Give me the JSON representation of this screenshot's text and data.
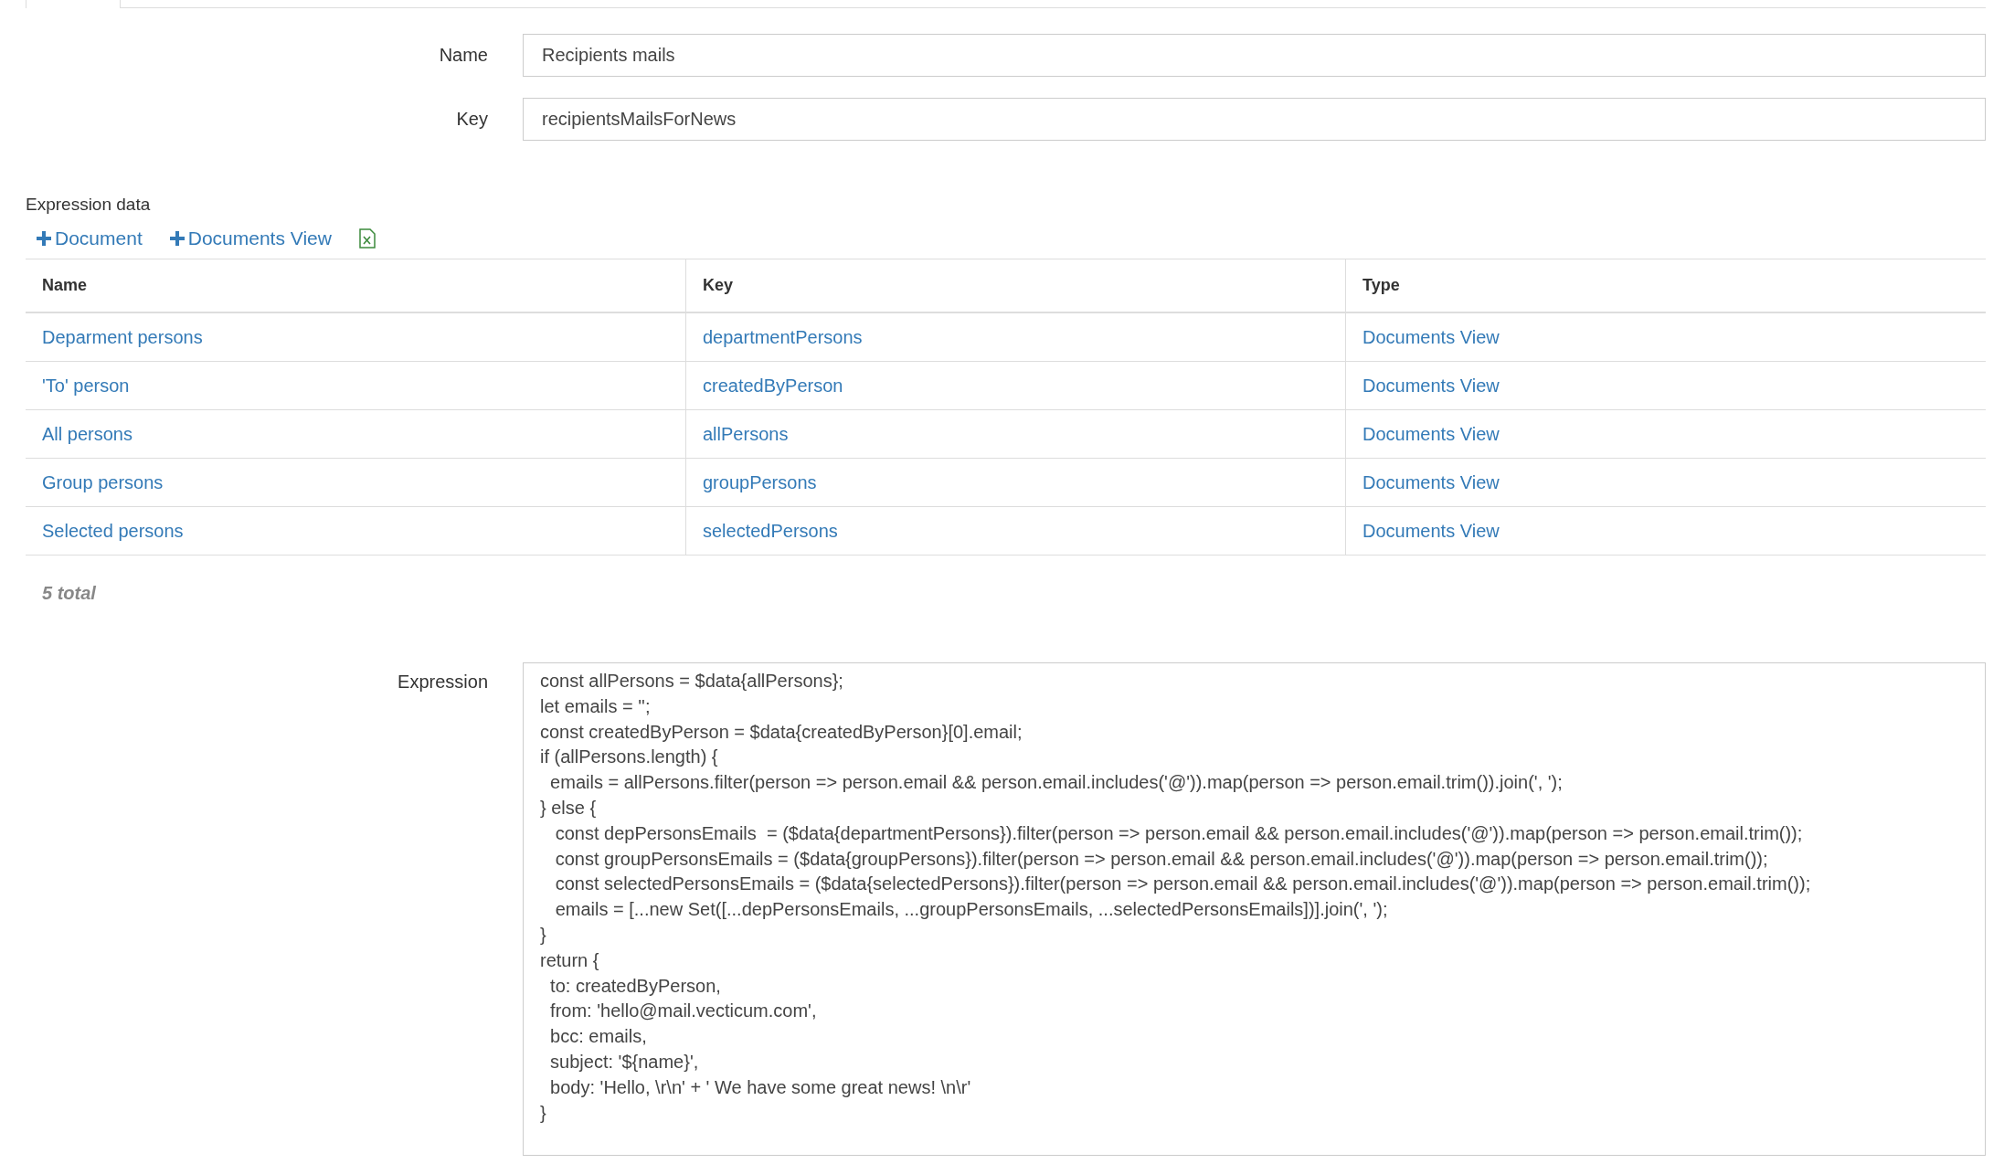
{
  "form": {
    "fields": [
      {
        "label": "Name",
        "value": "Recipients mails"
      },
      {
        "label": "Key",
        "value": "recipientsMailsForNews"
      }
    ]
  },
  "expression_data": {
    "title": "Expression data",
    "actions": [
      {
        "kind": "add",
        "label": "Document"
      },
      {
        "kind": "add",
        "label": "Documents View"
      },
      {
        "kind": "excel"
      }
    ],
    "table": {
      "columns": [
        "Name",
        "Key",
        "Type"
      ],
      "rows": [
        [
          "Deparment persons",
          "departmentPersons",
          "Documents View"
        ],
        [
          "'To' person",
          "createdByPerson",
          "Documents View"
        ],
        [
          "All persons",
          "allPersons",
          "Documents View"
        ],
        [
          "Group persons",
          "groupPersons",
          "Documents View"
        ],
        [
          "Selected persons",
          "selectedPersons",
          "Documents View"
        ]
      ]
    },
    "total": "5 total"
  },
  "expression": {
    "label": "Expression",
    "value": "const allPersons = $data{allPersons};\nlet emails = '';\nconst createdByPerson = $data{createdByPerson}[0].email;\nif (allPersons.length) {\n  emails = allPersons.filter(person => person.email && person.email.includes('@')).map(person => person.email.trim()).join(', ');\n} else {\n   const depPersonsEmails  = ($data{departmentPersons}).filter(person => person.email && person.email.includes('@')).map(person => person.email.trim());\n   const groupPersonsEmails = ($data{groupPersons}).filter(person => person.email && person.email.includes('@')).map(person => person.email.trim());\n   const selectedPersonsEmails = ($data{selectedPersons}).filter(person => person.email && person.email.includes('@')).map(person => person.email.trim());\n   emails = [...new Set([...depPersonsEmails, ...groupPersonsEmails, ...selectedPersonsEmails])].join(', ');\n}\nreturn {\n  to: createdByPerson,\n  from: 'hello@mail.vecticum.com',\n  bcc: emails,\n  subject: '${name}',\n  body: 'Hello, \\r\\n' + ' We have some great news! \\n\\r'\n}"
  }
}
